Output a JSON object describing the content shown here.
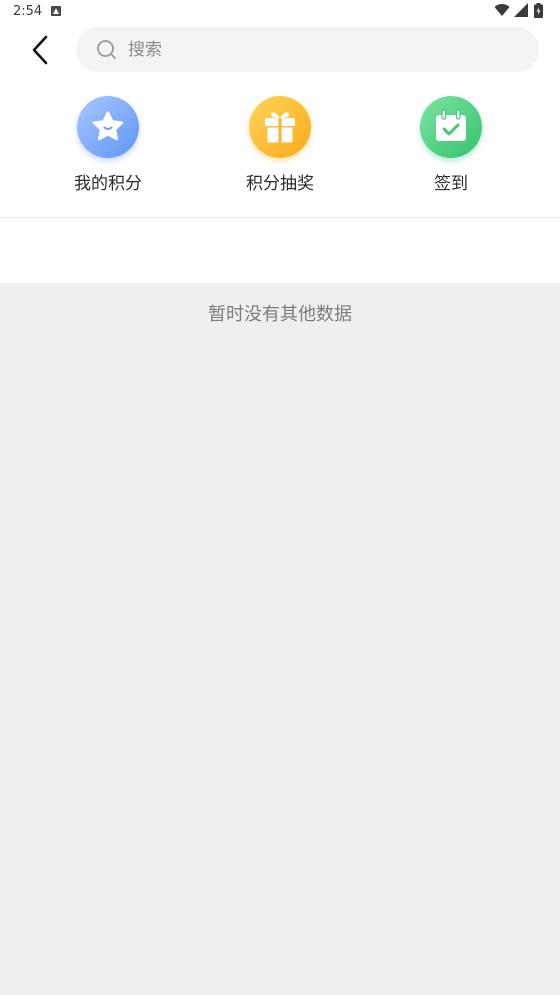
{
  "status_bar": {
    "time": "2:54",
    "icons": [
      "notification-icon",
      "wifi-icon",
      "signal-icon",
      "battery-icon"
    ]
  },
  "header": {
    "back_icon": "chevron-left-icon",
    "search": {
      "placeholder": "搜索",
      "value": "",
      "icon": "search-icon"
    }
  },
  "entries": [
    {
      "label": "我的积分",
      "icon": "star-icon",
      "color": "#6b9ff7"
    },
    {
      "label": "积分抽奖",
      "icon": "gift-icon",
      "color": "#fdb52d"
    },
    {
      "label": "签到",
      "icon": "calendar-check-icon",
      "color": "#46c97b"
    }
  ],
  "content": {
    "empty_message": "暂时没有其他数据"
  },
  "colors": {
    "page_background": "#efefef",
    "header_background": "#ffffff",
    "search_background": "#f3f4f6"
  }
}
